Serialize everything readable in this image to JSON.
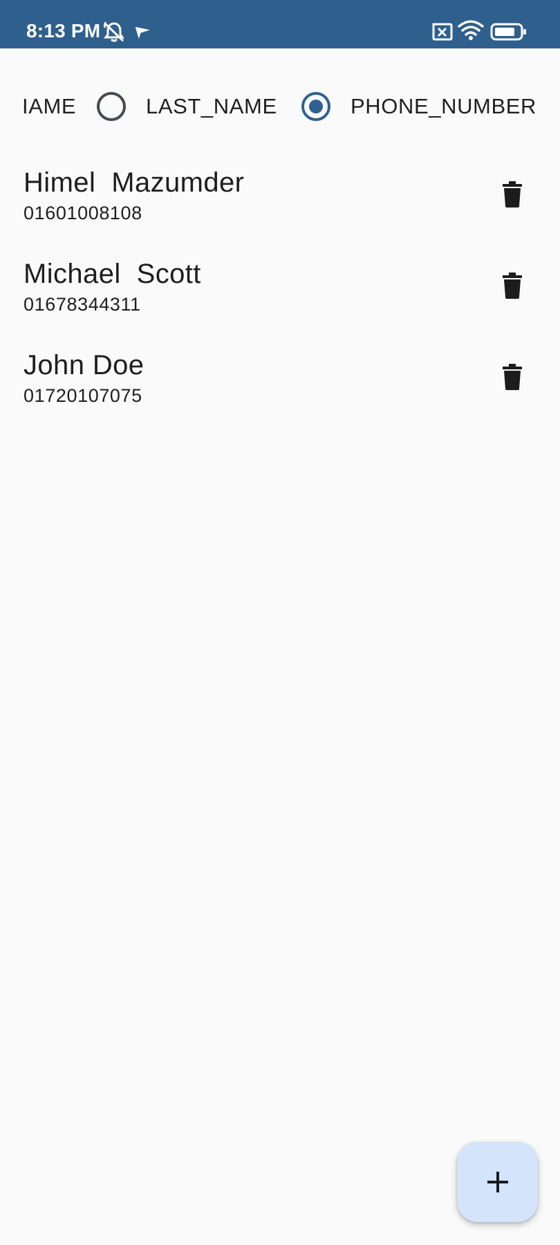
{
  "status_bar": {
    "time": "8:13 PM",
    "icons": [
      "alarm-off-icon",
      "navigation-arrow-icon",
      "sim-off-icon",
      "wifi-icon",
      "battery-icon"
    ],
    "background_color": "#2f5f8c"
  },
  "sort_options": {
    "items": [
      {
        "label": "FIRST_NAME",
        "selected": false
      },
      {
        "label": "LAST_NAME",
        "selected": false
      },
      {
        "label": "PHONE_NUMBER",
        "selected": true
      }
    ],
    "visible_first_fragment": "IAME",
    "accent_color": "#2f6190"
  },
  "contacts": [
    {
      "name": "Himel  Mazumder",
      "phone": "01601008108"
    },
    {
      "name": "Michael  Scott",
      "phone": "01678344311"
    },
    {
      "name": "John Doe",
      "phone": "01720107075"
    }
  ],
  "fab": {
    "icon": "plus-icon",
    "background_color": "#d3e4fb"
  }
}
